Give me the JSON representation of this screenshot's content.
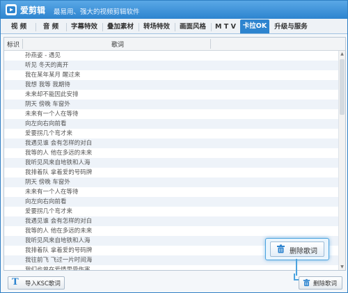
{
  "app": {
    "title": "爱剪辑",
    "slogan": "最易用、强大的视频剪辑软件"
  },
  "tabs": [
    {
      "label": "视  频"
    },
    {
      "label": "音  频"
    },
    {
      "label": "字幕特效"
    },
    {
      "label": "叠加素材"
    },
    {
      "label": "转场特效"
    },
    {
      "label": "画面风格"
    },
    {
      "label": "M T V"
    },
    {
      "label": "卡拉OK",
      "active": true
    },
    {
      "label": "升级与服务"
    }
  ],
  "table": {
    "col_mark": "标识",
    "col_lyrics": "歌词",
    "rows": [
      "孙燕姿 - 遇见",
      "听见 冬天的离开",
      "我在某年某月 醒过来",
      "我想 我等 我期待",
      "未来却不能因此安排",
      "阴天 傍晚 车窗外",
      "未来有一个人在等待",
      "向左向右向前看",
      "爱要拐几个弯才来",
      "我遇见谁 会有怎样的对白",
      "我等的人 他在多远的未来",
      "我听见风来自地铁和人海",
      "我排着队 拿着爱的号码牌",
      "阴天 傍晚 车窗外",
      "未来有一个人在等待",
      "向左向右向前看",
      "爱要拐几个弯才来",
      "我遇见谁 会有怎样的对白",
      "我等的人 他在多远的未来",
      "我听见风来自地铁和人海",
      "我排着队 拿着爱的号码牌",
      "我往前飞 飞过一片时间海",
      "我们也曾在爱情里受伤害"
    ]
  },
  "buttons": {
    "import_label": "导入KSC歌词",
    "delete_label": "删除歌词"
  },
  "callout": {
    "label": "删除歌词"
  },
  "colors": {
    "accent": "#2d84cf"
  }
}
